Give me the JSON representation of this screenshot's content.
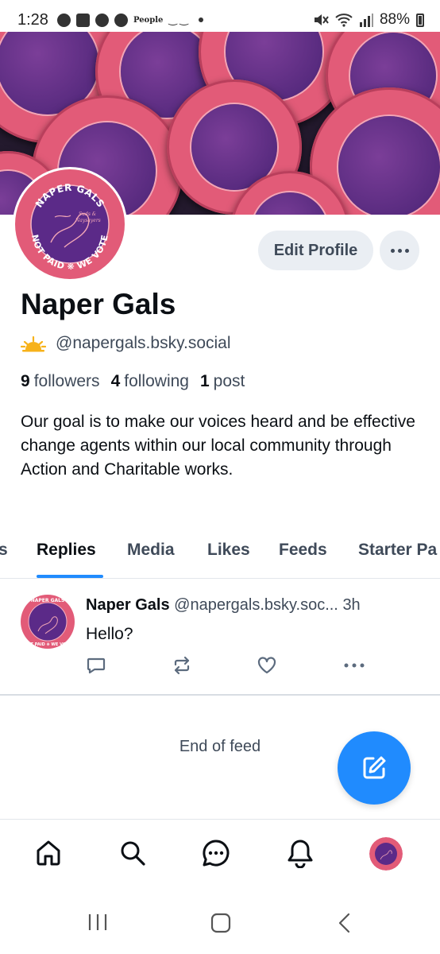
{
  "status_bar": {
    "time": "1:28",
    "people_label": "People",
    "battery": "88%"
  },
  "profile": {
    "display_name": "Naper Gals",
    "handle": "@napergals.bsky.social",
    "edit_button": "Edit Profile",
    "avatar_text_top": "NAPER GALS",
    "avatar_text_bottom": "NOT PAID ❋ WE VOTE",
    "avatar_script": "Suds & Naysayers",
    "stats": {
      "followers_count": "9",
      "followers_label": "followers",
      "following_count": "4",
      "following_label": "following",
      "posts_count": "1",
      "posts_label": "post"
    },
    "bio": "Our goal is to make our voices heard and be effective change agents within our local community through Action and Charitable works."
  },
  "tabs": [
    "ts",
    "Replies",
    "Media",
    "Likes",
    "Feeds",
    "Starter Pa"
  ],
  "active_tab": "Replies",
  "post": {
    "author": "Naper Gals",
    "handle": "@napergals.bsky.soc...",
    "time": "3h",
    "text": "Hello?"
  },
  "feed_end": "End of feed",
  "icons": {
    "reply": "speech-bubble-icon",
    "repost": "repost-arrows-icon",
    "like": "heart-icon",
    "more": "ellipsis-icon",
    "compose": "compose-icon",
    "home": "home-icon",
    "search": "search-icon",
    "chat": "chat-icon",
    "notifications": "bell-icon"
  },
  "colors": {
    "accent": "#208bfe",
    "badge_pink": "#e25b78",
    "badge_purple": "#5b2a88",
    "text_primary": "#0b0f14",
    "text_secondary": "#3f4a59",
    "button_bg": "#eaeef3"
  }
}
